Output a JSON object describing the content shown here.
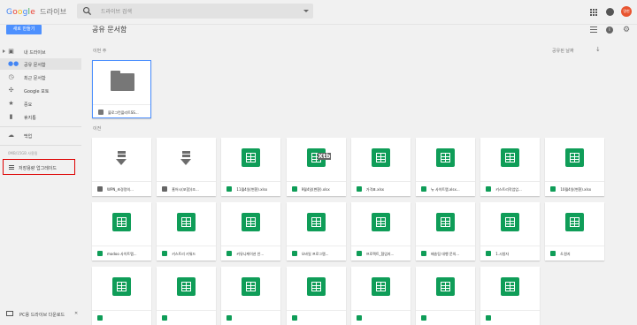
{
  "app": {
    "logo_letters": [
      "G",
      "o",
      "o",
      "g",
      "l",
      "e"
    ],
    "product": "드라이브",
    "avatar_text": "명현"
  },
  "search": {
    "placeholder": "드라이브 검색"
  },
  "toolbar": {
    "new_button": "새로 만들기",
    "page_title": "공유 문서함"
  },
  "sidebar": {
    "items": [
      {
        "label": "내 드라이브",
        "icon": "drive-icon",
        "has_caret": true
      },
      {
        "label": "공유 문서함",
        "icon": "people-icon",
        "active": true
      },
      {
        "label": "최근 문서함",
        "icon": "clock-icon"
      },
      {
        "label": "Google 포토",
        "icon": "pinwheel-icon"
      },
      {
        "label": "중요",
        "icon": "star-icon"
      },
      {
        "label": "휴지통",
        "icon": "trash-icon"
      },
      {
        "label": "백업",
        "icon": "cloud-icon"
      }
    ],
    "storage_text": "0MB/15GB 사용됨",
    "upgrade_label": "저장용량 업그레이드",
    "download_label": "PC용 드라이브 다운로드",
    "close_glyph": "✕"
  },
  "main": {
    "sort_label": "공유된 날짜",
    "section_recent": "이번 주",
    "section_earlier": "이전",
    "recent_cards": [
      {
        "name": "블로그컨플리트SS...",
        "type": "folder"
      }
    ],
    "cards": [
      {
        "name": "WPN_초경량의...",
        "type": "download"
      },
      {
        "name": "홈어시(포함)(조...",
        "type": "download"
      },
      {
        "name": "11월4일(변환).xlsx",
        "type": "sheet"
      },
      {
        "name": "9월4일(변환).xlsx",
        "type": "sheet",
        "overlay": "Xtb"
      },
      {
        "name": "가격표.xlsx",
        "type": "sheet"
      },
      {
        "name": "뉴 사이트맵.xlsx...",
        "type": "sheet"
      },
      {
        "name": "키스트리작업업...",
        "type": "sheet"
      },
      {
        "name": "10월4일(변환).xlsx",
        "type": "sheet"
      },
      {
        "name": "modoo 사이트맵...",
        "type": "sheet"
      },
      {
        "name": "키스트리 키워드",
        "type": "sheet"
      },
      {
        "name": "커뮤니케이션 안...",
        "type": "sheet"
      },
      {
        "name": "오바일 프로그램...",
        "type": "sheet"
      },
      {
        "name": "프로젝트_협업지...",
        "type": "sheet"
      },
      {
        "name": "배송팀 대행 문의...",
        "type": "sheet"
      },
      {
        "name": "1.시청자",
        "type": "sheet"
      },
      {
        "name": "4.원지",
        "type": "sheet"
      },
      {
        "name": "",
        "type": "sheet"
      },
      {
        "name": "",
        "type": "sheet"
      },
      {
        "name": "",
        "type": "sheet"
      },
      {
        "name": "",
        "type": "sheet"
      },
      {
        "name": "",
        "type": "sheet"
      },
      {
        "name": "",
        "type": "sheet"
      },
      {
        "name": "",
        "type": "sheet"
      }
    ]
  },
  "colors": {
    "accent": "#4d90fe",
    "sheet": "#0f9d58",
    "highlight_border": "#dd0000"
  }
}
